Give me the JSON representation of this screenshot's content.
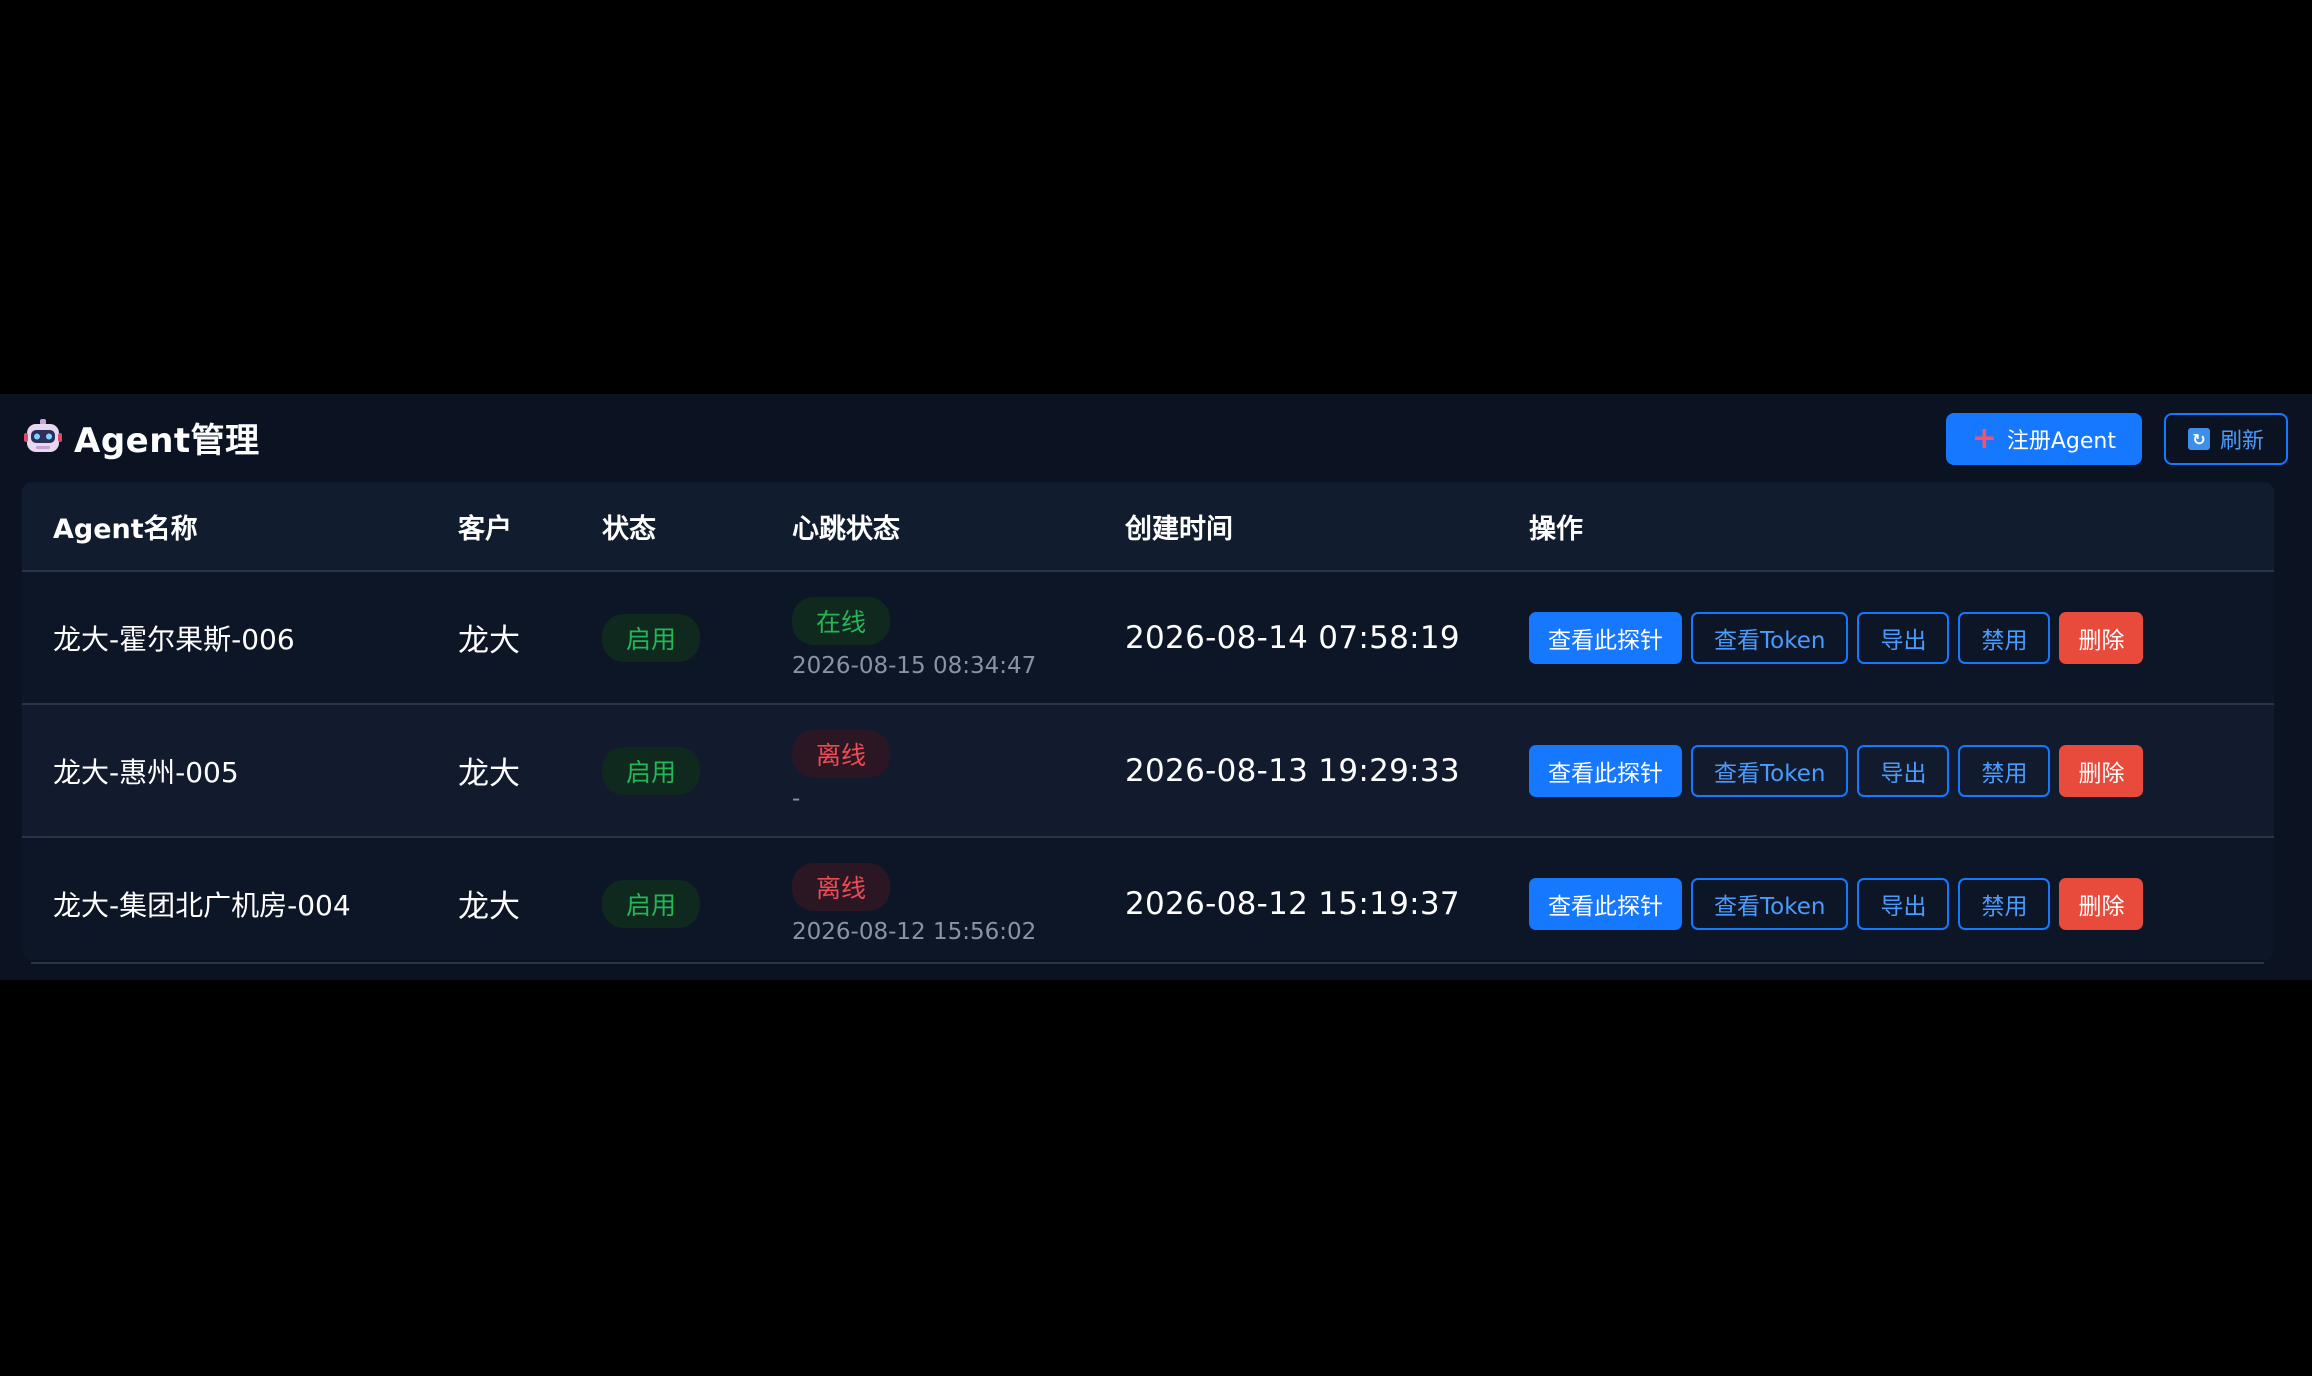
{
  "header": {
    "title": "Agent管理",
    "icon": "robot-icon",
    "register_label": "注册Agent",
    "refresh_label": "刷新"
  },
  "table": {
    "columns": [
      "Agent名称",
      "客户",
      "状态",
      "心跳状态",
      "创建时间",
      "操作"
    ],
    "rows": [
      {
        "name": "龙大-霍尔果斯-006",
        "customer": "龙大",
        "status": "启用",
        "heartbeat": "在线",
        "heartbeat_state": "online",
        "heartbeat_time": "2026-08-15 08:34:47",
        "created": "2026-08-14 07:58:19"
      },
      {
        "name": "龙大-惠州-005",
        "customer": "龙大",
        "status": "启用",
        "heartbeat": "离线",
        "heartbeat_state": "offline",
        "heartbeat_time": "-",
        "created": "2026-08-13 19:29:33"
      },
      {
        "name": "龙大-集团北广机房-004",
        "customer": "龙大",
        "status": "启用",
        "heartbeat": "离线",
        "heartbeat_state": "offline",
        "heartbeat_time": "2026-08-12 15:56:02",
        "created": "2026-08-12 15:19:37"
      }
    ],
    "actions": {
      "view_probe": "查看此探针",
      "view_token": "查看Token",
      "export": "导出",
      "disable": "禁用",
      "delete": "删除"
    }
  },
  "colors": {
    "page_bg": "#000000",
    "panel_bg": "#0b1322",
    "accent": "#1677ff",
    "success": "#25b654",
    "danger": "#e84b3c"
  }
}
